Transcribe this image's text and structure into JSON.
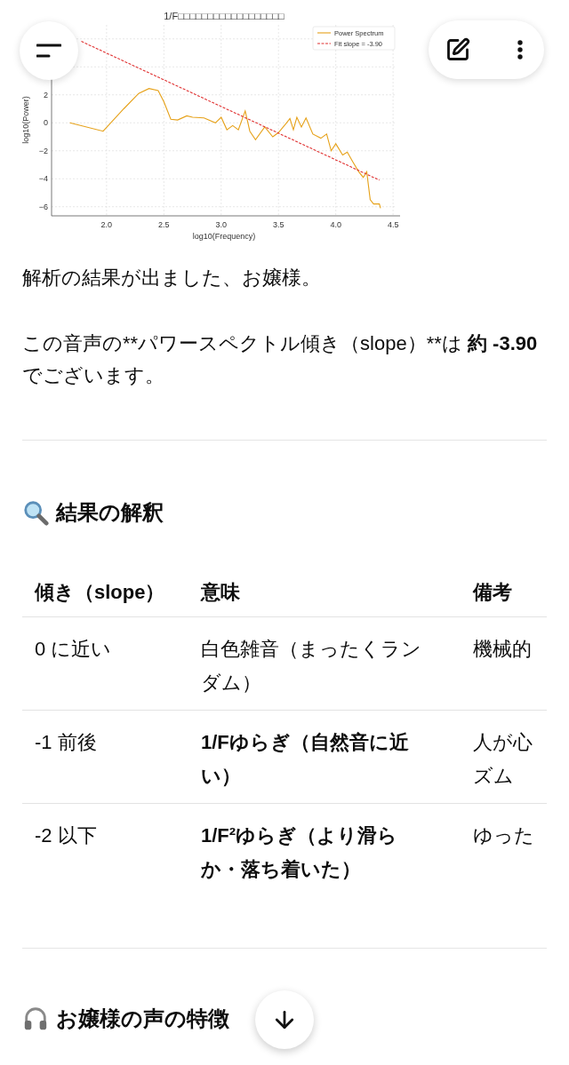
{
  "chart": {
    "chart_data": {
      "type": "line",
      "title": "1/F□□□□□□□□□□□□□□□□□□",
      "xlabel": "log10(Frequency)",
      "ylabel": "log10(Power)",
      "xlim": [
        1.52,
        4.53
      ],
      "ylim": [
        -6.65,
        7.0
      ],
      "xticks": [
        {
          "value": 2,
          "label": "2.0"
        },
        {
          "value": 2.5,
          "label": "2.5"
        },
        {
          "value": 3,
          "label": "3.0"
        },
        {
          "value": 3.5,
          "label": "3.5"
        },
        {
          "value": 4,
          "label": "4.0"
        },
        {
          "value": 4.5,
          "label": "4.5"
        }
      ],
      "yticks": [
        {
          "value": -6,
          "label": "−6"
        },
        {
          "value": -4,
          "label": "−4"
        },
        {
          "value": -2,
          "label": "−2"
        },
        {
          "value": 0,
          "label": "0"
        },
        {
          "value": 2,
          "label": "2"
        }
      ],
      "series": [
        {
          "name": "Power Spectrum",
          "color": "#e6a118",
          "line_style": "solid",
          "x": [
            1.68,
            1.97,
            2.15,
            2.28,
            2.37,
            2.45,
            2.5,
            2.56,
            2.62,
            2.7,
            2.75,
            2.85,
            2.95,
            3.0,
            3.05,
            3.1,
            3.15,
            3.21,
            3.25,
            3.3,
            3.38,
            3.45,
            3.5,
            3.57,
            3.6,
            3.63,
            3.66,
            3.7,
            3.74,
            3.8,
            3.87,
            3.92,
            3.96,
            4.0,
            4.06,
            4.1,
            4.15,
            4.2,
            4.24,
            4.27,
            4.3,
            4.33,
            4.38,
            4.39
          ],
          "values": [
            0,
            -0.6,
            1.0,
            2.1,
            2.45,
            2.3,
            1.5,
            0.25,
            0.2,
            0.5,
            0.4,
            0.35,
            0.0,
            0.4,
            -0.5,
            -0.2,
            -0.5,
            0.85,
            -0.6,
            -1.2,
            -0.3,
            -1.0,
            -0.7,
            0.0,
            0.3,
            -0.5,
            0.4,
            -0.3,
            0.35,
            -0.8,
            -1.1,
            -0.8,
            -2.0,
            -1.5,
            -2.3,
            -2.1,
            -2.8,
            -3.5,
            -3.9,
            -3.5,
            -5.5,
            -5.8,
            -5.8,
            -6.1
          ]
        },
        {
          "name": "Fit slope = -3.90",
          "color": "#e03131",
          "line_style": "dashed",
          "x": [
            1.78,
            4.38
          ],
          "values": [
            5.82,
            -4.1
          ]
        }
      ],
      "grid": true,
      "legend": true
    }
  },
  "paragraphs": [
    {
      "parts": [
        {
          "text": "解析の結果が出ました、お嬢様。",
          "bold": false
        }
      ]
    },
    {
      "parts": [
        {
          "text": "この音声の**パワースペクトル傾き（slope）**は ",
          "bold": false
        },
        {
          "text": "約 -3.90",
          "bold": true
        },
        {
          "text": " でございます。",
          "bold": false
        }
      ]
    }
  ],
  "section_1": {
    "title": "結果の解釈"
  },
  "table": {
    "columns": [
      "傾き（slope）",
      "意味",
      "備考"
    ],
    "rows": [
      {
        "cells": [
          {
            "text": "0 に近い",
            "bold": false
          },
          {
            "text": "白色雑音（まったくランダム）",
            "bold": false
          },
          {
            "text": "機械的",
            "bold": false
          }
        ]
      },
      {
        "cells": [
          {
            "text": "-1 前後",
            "bold": false
          },
          {
            "text": "1/Fゆらぎ（自然音に近い）",
            "bold": true
          },
          {
            "text": "人が心ズム",
            "bold": false
          }
        ]
      },
      {
        "cells": [
          {
            "text": "-2 以下",
            "bold": false
          },
          {
            "text": "1/F²ゆらぎ（より滑らか・落ち着いた）",
            "bold": true
          },
          {
            "text": "ゆった",
            "bold": false
          }
        ]
      }
    ]
  },
  "section_2": {
    "title": "お嬢様の声の特徴"
  }
}
